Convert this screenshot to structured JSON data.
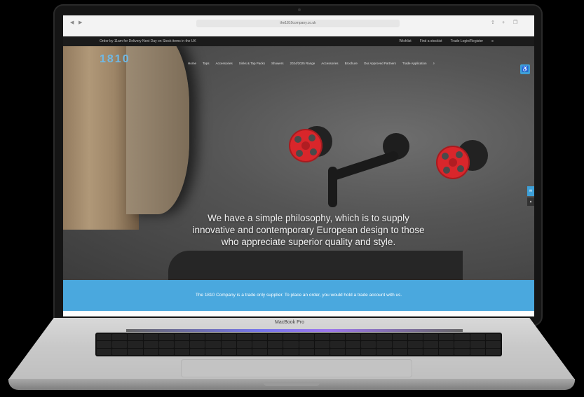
{
  "device": {
    "model_label": "MacBook Pro"
  },
  "browser": {
    "back_icon": "chevron-left-icon",
    "forward_icon": "chevron-right-icon",
    "url": "the1810company.co.uk"
  },
  "topbar": {
    "promo": "Order by 11am for Delivery Next Day on Stock items in the UK",
    "links": [
      "Wishlist",
      "Find a stockist",
      "Trade Login/Register",
      "≡"
    ]
  },
  "header": {
    "logo": "1810",
    "menu": [
      "Home",
      "Taps",
      "Accessories",
      "Sinks & Tap Packs",
      "Showers",
      "2024/2025 Range",
      "Accessories",
      "Brochure",
      "Our Approved Partners",
      "Trade Application"
    ],
    "search_icon": "search-icon",
    "accessibility_icon": "accessibility-icon"
  },
  "hero": {
    "tagline": [
      "We have a simple philosophy, which is to supply",
      "innovative and contemporary European design to those",
      "who appreciate superior quality and style."
    ]
  },
  "banner": {
    "text": "The 1810 Company is a trade only supplier. To place an order, you would hold a trade account with us."
  },
  "colors": {
    "accent": "#4aa8de",
    "tap_wheel": "#d9262b",
    "topbar": "#1b1b1b"
  }
}
